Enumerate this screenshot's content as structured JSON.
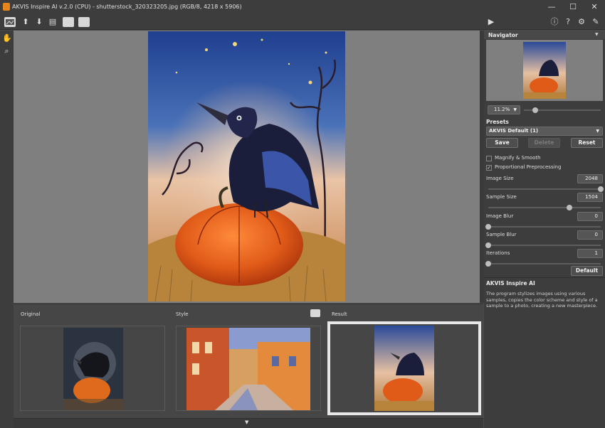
{
  "window": {
    "title": "AKVIS Inspire AI v.2.0 (CPU) - shutterstock_320323205.jpg (RGB/8, 4218 x 5906)",
    "minimize": "—",
    "maximize": "☐",
    "close": "✕"
  },
  "toolbar": {
    "left_icons": [
      "open-image-icon",
      "save-icon",
      "export-icon",
      "print-icon",
      "batch-icon",
      "style-library-icon"
    ],
    "right_icons": [
      "run-icon",
      "info-icon",
      "help-icon",
      "settings-icon",
      "feedback-icon"
    ]
  },
  "tools": [
    "hand-icon",
    "zoom-icon"
  ],
  "thumbnails": {
    "original_label": "Original",
    "style_label": "Style",
    "result_label": "Result"
  },
  "navigator": {
    "title": "Navigator",
    "zoom": "11.2%",
    "zoom_level": 0.15
  },
  "presets": {
    "title": "Presets",
    "selected": "AKVIS Default (1)",
    "save": "Save",
    "delete": "Delete",
    "reset": "Reset"
  },
  "settings": {
    "magnify": {
      "label": "Magnify & Smooth",
      "checked": false
    },
    "preprocess": {
      "label": "Proportional Preprocessing",
      "checked": true
    },
    "sliders": [
      {
        "label": "Image Size",
        "value": "2048",
        "level": 1.0
      },
      {
        "label": "Sample Size",
        "value": "1504",
        "level": 0.72
      },
      {
        "label": "Image Blur",
        "value": "0",
        "level": 0.0
      },
      {
        "label": "Sample Blur",
        "value": "0",
        "level": 0.0
      },
      {
        "label": "Iterations",
        "value": "1",
        "level": 0.0
      }
    ],
    "default_button": "Default"
  },
  "info": {
    "title": "AKVIS Inspire AI",
    "text": "The program stylizes images using various samples, copies the color scheme and style of a sample to a photo, creating a new masterpiece."
  },
  "colors": {
    "accent": "#e85c1c",
    "sky": "#2f4f9e",
    "background": "#4a4a4a"
  }
}
